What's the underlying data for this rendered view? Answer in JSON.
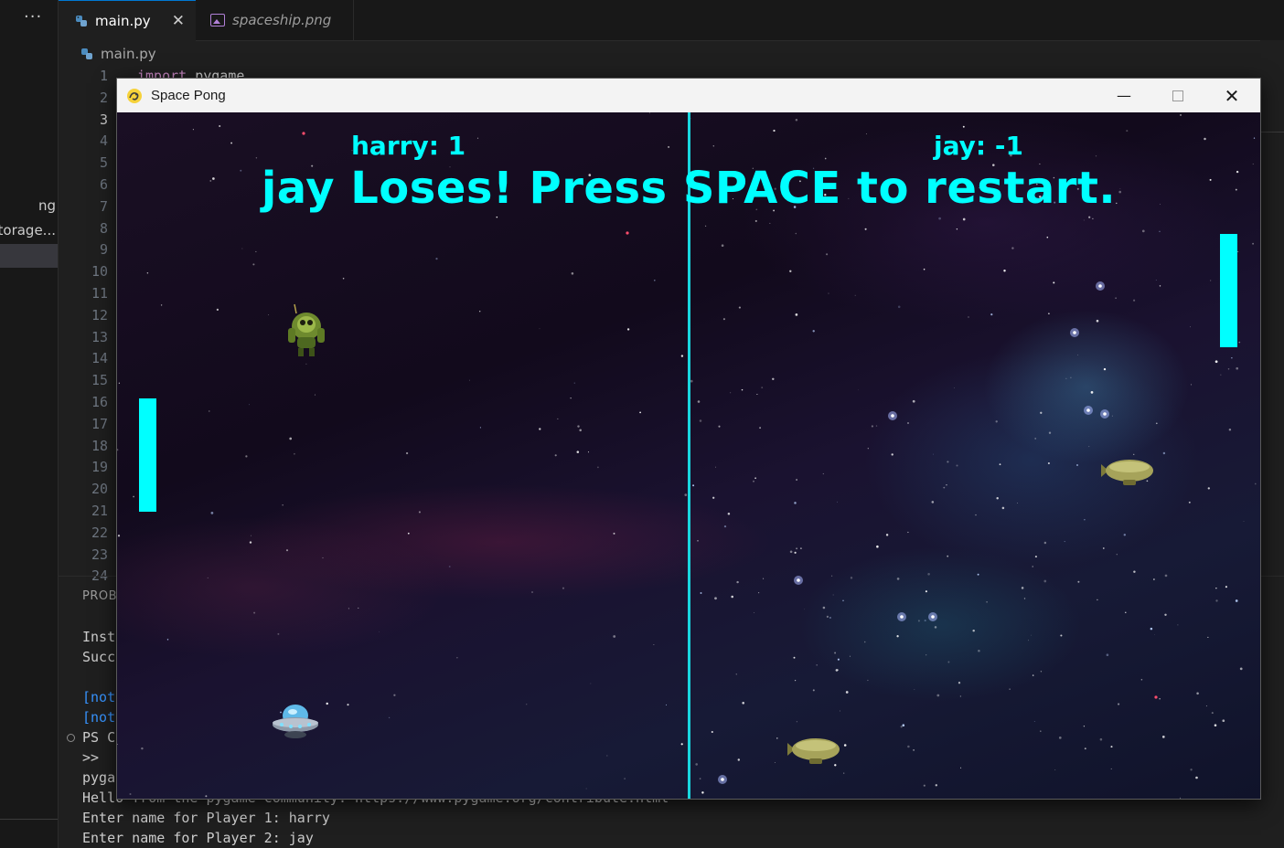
{
  "explorer": {
    "more_label": "···",
    "items": [
      "ng",
      "storage..."
    ]
  },
  "editor": {
    "tabs": [
      {
        "label": "main.py",
        "close": "✕"
      },
      {
        "label": "spaceship.png"
      }
    ],
    "breadcrumb": "main.py",
    "line_numbers": [
      "1",
      "2",
      "3",
      "4",
      "5",
      "6",
      "7",
      "8",
      "9",
      "10",
      "11",
      "12",
      "13",
      "14",
      "15",
      "16",
      "17",
      "18",
      "19",
      "20",
      "21",
      "22",
      "23",
      "24"
    ],
    "code_peek": {
      "keyword": "import",
      "module": "pygame"
    }
  },
  "panel": {
    "title": "PROBL",
    "terminal_lines": [
      "Inst",
      "Succ",
      "[not",
      "[not",
      "PS C",
      ">>",
      "pyga",
      "Hello from the pygame community. https://www.pygame.org/contribute.html",
      "Enter name for Player 1: harry",
      "Enter name for Player 2: jay"
    ]
  },
  "game_window": {
    "title": "Space Pong",
    "controls": {
      "minimize": "—",
      "close": "✕"
    },
    "score_left": "harry: 1",
    "score_right": "jay: -1",
    "message": "jay Loses! Press SPACE to restart.",
    "colors": {
      "accent": "#00ffff",
      "midline": "#19d6df",
      "background": "#120a1c"
    }
  },
  "icons": [
    "python-file-icon",
    "image-file-icon",
    "pygame-snake-icon",
    "alien-sprite",
    "ufo-sprite",
    "blimp-sprite"
  ]
}
